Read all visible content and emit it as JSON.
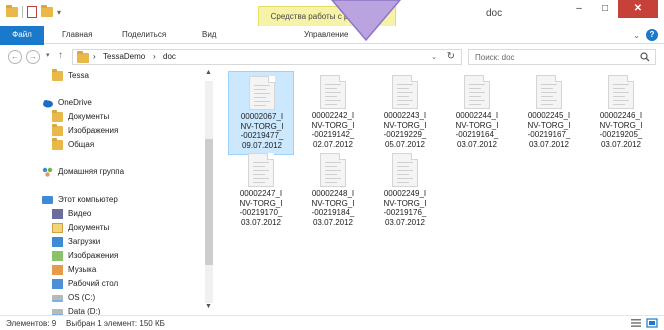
{
  "window": {
    "title": "doc",
    "tools_banner": "Средства работы с рисунками",
    "controls": {
      "minimize": "–",
      "maximize": "□",
      "close": "✕"
    }
  },
  "ribbon": {
    "file_tab": "Файл",
    "tabs": [
      "Главная",
      "Поделиться",
      "Вид",
      "Управление"
    ],
    "help": "?",
    "expand": "⌄"
  },
  "address": {
    "back": "←",
    "forward": "→",
    "recent": "▾",
    "up": "↑",
    "crumbs": [
      "TessaDemo",
      "doc"
    ],
    "separator": "›",
    "dropdown": "⌄",
    "refresh": "↻",
    "search_placeholder": "Поиск: doc"
  },
  "nav": {
    "items": [
      {
        "label": "Tessa",
        "icon": "folder-icon"
      },
      {
        "label": "OneDrive",
        "icon": "cloud-icon"
      },
      {
        "label": "Документы",
        "icon": "folder-icon"
      },
      {
        "label": "Изображения",
        "icon": "folder-icon"
      },
      {
        "label": "Общая",
        "icon": "folder-icon"
      },
      {
        "label": "Домашняя группа",
        "icon": "homegroup-icon"
      },
      {
        "label": "Этот компьютер",
        "icon": "computer-icon"
      },
      {
        "label": "Видео",
        "icon": "video-icon"
      },
      {
        "label": "Документы",
        "icon": "documents-icon"
      },
      {
        "label": "Загрузки",
        "icon": "downloads-icon"
      },
      {
        "label": "Изображения",
        "icon": "pictures-icon"
      },
      {
        "label": "Музыка",
        "icon": "music-icon"
      },
      {
        "label": "Рабочий стол",
        "icon": "desktop-icon"
      },
      {
        "label": "OS (C:)",
        "icon": "drive-icon"
      },
      {
        "label": "Data (D:)",
        "icon": "drive-icon"
      }
    ]
  },
  "files": [
    {
      "name": "00002067_I\nNV-TORG_I\n-00219477_\n09.07.2012",
      "selected": true
    },
    {
      "name": "00002242_I\nNV-TORG_I\n-00219142_\n02.07.2012",
      "selected": false
    },
    {
      "name": "00002243_I\nNV-TORG_I\n-00219229_\n05.07.2012",
      "selected": false
    },
    {
      "name": "00002244_I\nNV-TORG_I\n-00219164_\n03.07.2012",
      "selected": false
    },
    {
      "name": "00002245_I\nNV-TORG_I\n-00219167_\n03.07.2012",
      "selected": false
    },
    {
      "name": "00002246_I\nNV-TORG_I\n-00219205_\n03.07.2012",
      "selected": false
    },
    {
      "name": "00002247_I\nNV-TORG_I\n-00219170_\n03.07.2012",
      "selected": false
    },
    {
      "name": "00002248_I\nNV-TORG_I\n-00219184_\n03.07.2012",
      "selected": false
    },
    {
      "name": "00002249_I\nNV-TORG_I\n-00219176_\n03.07.2012",
      "selected": false
    }
  ],
  "status": {
    "count": "Элементов: 9",
    "selection": "Выбран 1 элемент: 150 КБ"
  },
  "colors": {
    "accent": "#1979ca",
    "selection": "#cce8ff",
    "tools_banner": "#f6f3a8",
    "close_button": "#c7413b",
    "callout": "#b9a4e0"
  }
}
